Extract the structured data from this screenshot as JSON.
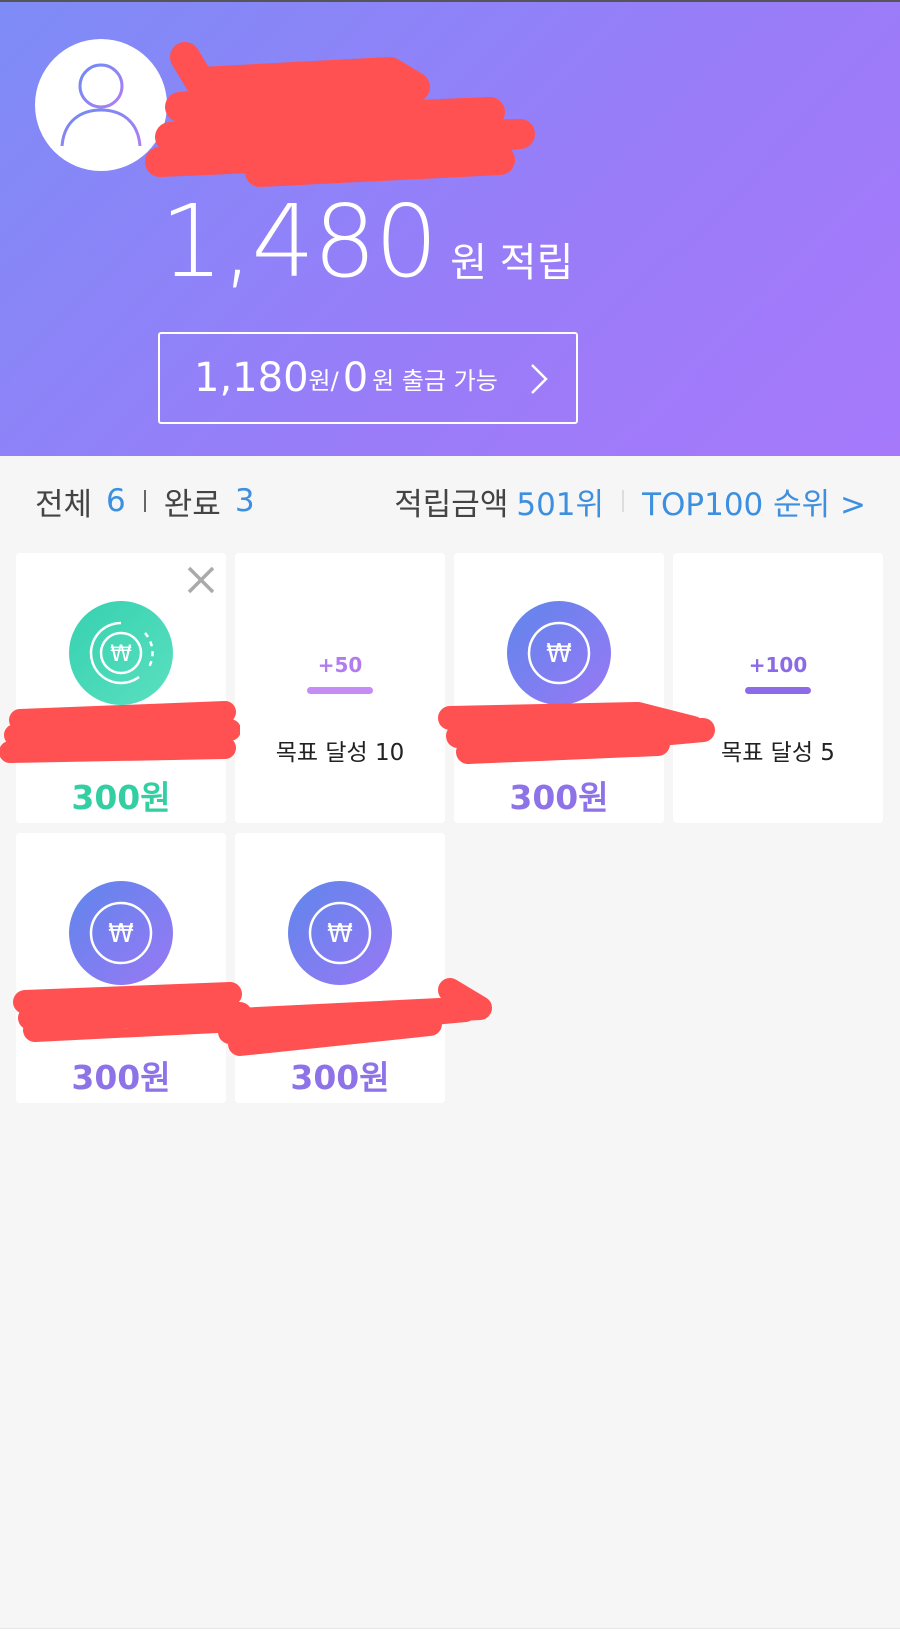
{
  "header": {
    "total_amount": "1,480",
    "total_unit": "원 적립",
    "withdraw": {
      "amount1": "1,180",
      "unit1": "원/",
      "amount2": "0",
      "unit2": "원 출금 가능"
    }
  },
  "stats": {
    "total_label": "전체",
    "total_count": "6",
    "done_label": "완료",
    "done_count": "3",
    "rank_label": "적립금액",
    "rank_value": "501위",
    "top_link": "TOP100 순위 >"
  },
  "cards": [
    {
      "type": "coin",
      "amount": "300원",
      "color": "#33cfa3"
    },
    {
      "type": "goal",
      "bonus": "+50",
      "label": "목표 달성 10",
      "color": "#b27cf0"
    },
    {
      "type": "coin",
      "amount": "300원",
      "color": "#8d72e8"
    },
    {
      "type": "goal",
      "bonus": "+100",
      "label": "목표 달성 5",
      "color": "#8b6ae8"
    },
    {
      "type": "coin",
      "amount": "300원",
      "color": "#8d72e8"
    },
    {
      "type": "coin",
      "amount": "300원",
      "color": "#8d72e8"
    }
  ],
  "icons": {
    "avatar": "user-icon",
    "coin": "won-coin-icon",
    "close": "close-icon",
    "chevron": "chevron-right-icon"
  }
}
